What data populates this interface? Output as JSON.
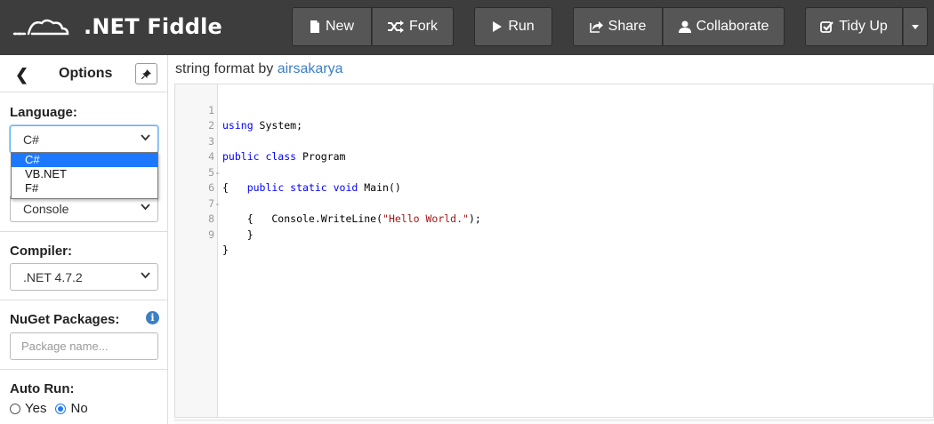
{
  "header": {
    "logo_text": ".NET Fiddle",
    "buttons": {
      "new": "New",
      "fork": "Fork",
      "run": "Run",
      "share": "Share",
      "collaborate": "Collaborate",
      "tidy_up": "Tidy Up"
    }
  },
  "sidebar": {
    "title": "Options",
    "language_label": "Language:",
    "language_value": "C#",
    "language_options": [
      "C#",
      "VB.NET",
      "F#"
    ],
    "project_type_value": "Console",
    "compiler_label": "Compiler:",
    "compiler_value": ".NET 4.7.2",
    "nuget_label": "NuGet Packages:",
    "nuget_placeholder": "Package name...",
    "autorun_label": "Auto Run:",
    "autorun_yes": "Yes",
    "autorun_no": "No",
    "autorun_selected": "No"
  },
  "main": {
    "fiddle_title_prefix": "string format by ",
    "author": "airsakarya",
    "code_lines": [
      {
        "n": "1",
        "mark": ""
      },
      {
        "n": "2",
        "mark": ""
      },
      {
        "n": "3",
        "mark": ""
      },
      {
        "n": "4",
        "mark": "-"
      },
      {
        "n": "5",
        "mark": ""
      },
      {
        "n": "6",
        "mark": "-"
      },
      {
        "n": "7",
        "mark": ""
      },
      {
        "n": "8",
        "mark": ""
      },
      {
        "n": "9",
        "mark": ""
      }
    ],
    "code": {
      "l1_kw": "using",
      "l1_rest": " System;",
      "l3_kw": "public class",
      "l3_rest": " Program",
      "l4": "{",
      "l5_indent": "    ",
      "l5_kw": "public static void",
      "l5_rest": " Main()",
      "l6": "    {",
      "l7_pre": "        Console.WriteLine(",
      "l7_str": "\"Hello World.\"",
      "l7_post": ");",
      "l8": "    }",
      "l9": "}"
    }
  },
  "colors": {
    "topbar": "#3d3d3d",
    "button": "#565656",
    "accent": "#1e78ff",
    "link": "#3b7fc4",
    "keyword": "#0000ff",
    "string": "#a31515"
  }
}
